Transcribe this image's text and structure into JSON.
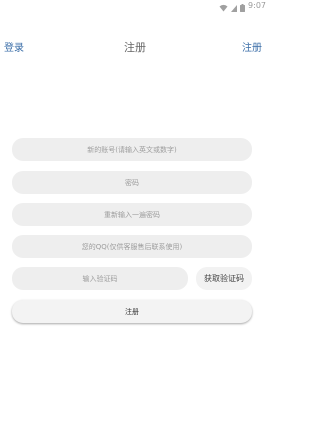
{
  "status_bar": {
    "time": "9:07",
    "icons": [
      "wifi-icon",
      "signal-icon",
      "battery-icon"
    ]
  },
  "header": {
    "left_link": "登录",
    "title": "注册",
    "right_link": "注册"
  },
  "form": {
    "account_placeholder": "新的账号(请输入英文或数字)",
    "password_placeholder": "密码",
    "confirm_password_placeholder": "重新输入一遍密码",
    "qq_placeholder": "您的QQ(仅供客服售后联系使用)",
    "captcha_placeholder": "输入验证码",
    "get_captcha_label": "获取验证码",
    "submit_label": "注册"
  },
  "colors": {
    "link": "#3b6ea8",
    "field_bg": "#eeeeee"
  }
}
